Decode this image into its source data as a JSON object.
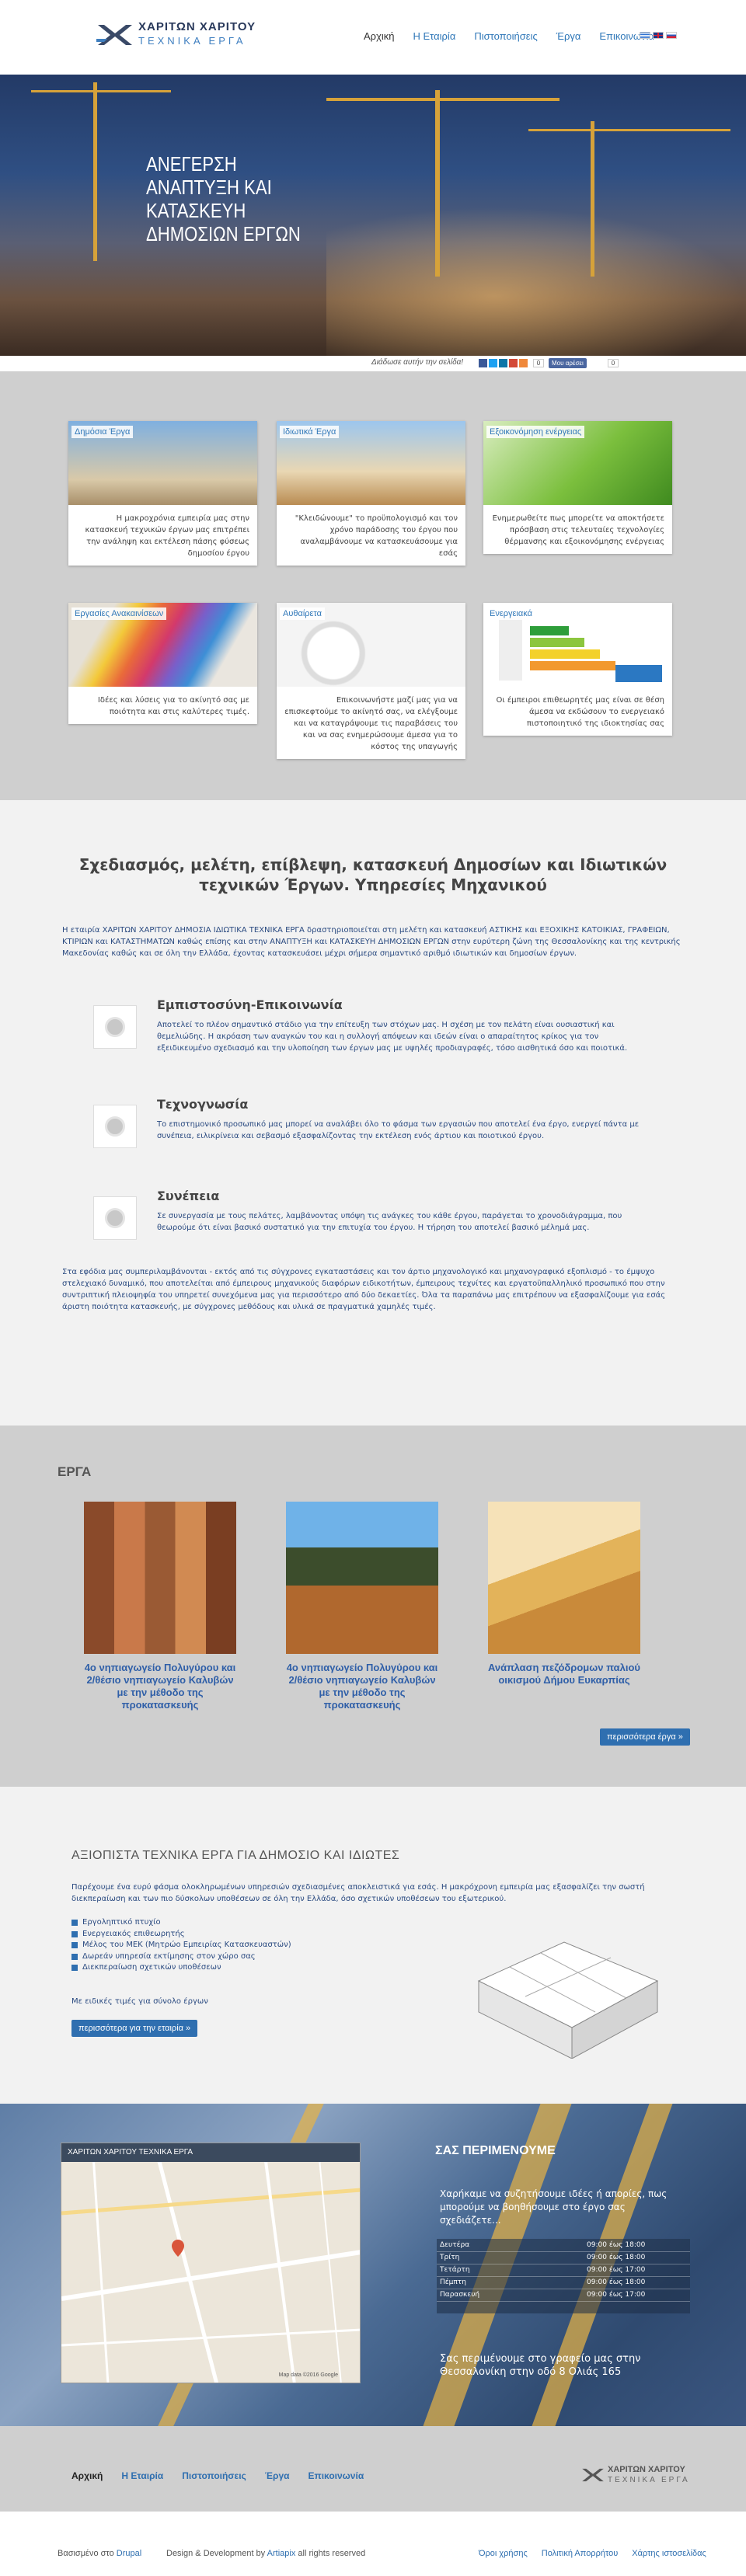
{
  "header": {
    "logo_title": "ΧΑΡΙΤΩΝ ΧΑΡΙΤΟΥ",
    "logo_subtitle": "ΤΕΧΝΙΚΑ ΕΡΓΑ",
    "nav": [
      "Αρχική",
      "Η Εταιρία",
      "Πιστοποιήσεις",
      "Έργα",
      "Επικοινωνία"
    ],
    "languages": [
      "greek-flag",
      "uk-flag",
      "russian-flag"
    ]
  },
  "hero": {
    "title": "ΑΝΕΓΕΡΣΗ ΑΝΑΠΤΥΞΗ ΚΑΙ ΚΑΤΑΣΚΕΥΗ ΔΗΜΟΣΙΩΝ ΕΡΓΩΝ"
  },
  "share": {
    "label": "Διάδωσε αυτήν την σελίδα!",
    "count": "0",
    "like_label": "Μου αρέσει",
    "like_count": "0"
  },
  "services": [
    {
      "label": "Δημόσια Έργα",
      "text": "Η μακροχρόνια εμπειρία μας στην κατασκευή τεχνικών έργων μας επιτρέπει την ανάληψη και εκτέλεση πάσης φύσεως δημοσίου έργου"
    },
    {
      "label": "Ιδιωτικά Έργα",
      "text": "\"Κλειδώνουμε\" το προϋπολογισμό και τον χρόνο παράδοσης του έργου που αναλαμβάνουμε να κατασκευάσουμε για εσάς"
    },
    {
      "label": "Εξοικονόμηση ενέργειας",
      "text": "Ενημερωθείτε πως μπορείτε να αποκτήσετε πρόσβαση στις τελευταίες τεχνολογίες θέρμανσης και εξοικονόμησης ενέργειας"
    },
    {
      "label": "Εργασίες Ανακαινίσεων",
      "text": "Ιδέες και λύσεις για το ακίνητό σας με ποιότητα και στις καλύτερες τιμές."
    },
    {
      "label": "Αυθαίρετα",
      "text": "Επικοινωνήστε μαζί μας για να επισκεφτούμε το ακίνητό σας, να ελέγξουμε και να καταγράψουμε τις παραβάσεις του και να σας ενημερώσουμε άμεσα για το κόστος της υπαγωγής"
    },
    {
      "label": "Ενεργειακά",
      "text": "Οι έμπειροι επιθεωρητές μας είναι σε θέση άμεσα να εκδώσουν το ενεργειακό πιστοποιητικό της ιδιοκτησίας σας"
    }
  ],
  "about": {
    "title": "Σχεδιασμός, μελέτη, επίβλεψη, κατασκευή Δημοσίων και Ιδιωτικών τεχνικών Έργων. Υπηρεσίες Μηχανικού",
    "intro": "Η εταιρία ΧΑΡΙΤΩΝ ΧΑΡΙΤΟΥ ΔΗΜΟΣΙΑ ΙΔΙΩΤΙΚΑ ΤΕΧΝΙΚΑ ΕΡΓΑ δραστηριοποιείται στη μελέτη και κατασκευή ΑΣΤΙΚΗΣ και ΕΞΟΧΙΚΗΣ ΚΑΤΟΙΚΙΑΣ, ΓΡΑΦΕΙΩΝ, ΚΤΙΡΙΩΝ και ΚΑΤΑΣΤΗΜΑΤΩΝ καθώς επίσης και στην ΑΝΑΠΤΥΞΗ και ΚΑΤΑΣΚΕΥΗ ΔΗΜΟΣΙΩΝ ΕΡΓΩΝ στην ευρύτερη ζώνη της Θεσσαλονίκης και της κεντρικής Μακεδονίας καθώς και σε όλη την Ελλάδα, έχοντας κατασκευάσει μέχρι σήμερα σημαντικό αριθμό ιδιωτικών και δημοσίων έργων.",
    "features": [
      {
        "title": "Εμπιστοσύνη-Επικοινωνία",
        "text": "Αποτελεί το πλέον σημαντικό στάδιο για την επίτευξη των στόχων μας. Η σχέση με τον πελάτη είναι ουσιαστική και θεμελιώδης. Η ακρόαση των αναγκών του και η συλλογή απόψεων και ιδεών είναι ο απαραίτητος κρίκος για τον εξειδικευμένο σχεδιασμό και την υλοποίηση των έργων μας με υψηλές προδιαγραφές, τόσο αισθητικά όσο και ποιοτικά."
      },
      {
        "title": "Τεχνογνωσία",
        "text": "Το επιστημονικό προσωπικό μας μπορεί να αναλάβει όλο το φάσμα των εργασιών που αποτελεί ένα έργο, ενεργεί πάντα με συνέπεια, ειλικρίνεια και σεβασμό εξασφαλίζοντας την εκτέλεση ενός άρτιου και ποιοτικού έργου."
      },
      {
        "title": "Συνέπεια",
        "text": "Σε συνεργασία με τους πελάτες, λαμβάνοντας υπόψη τις ανάγκες του κάθε έργου, παράγεται το χρονοδιάγραμμα, που θεωρούμε ότι είναι βασικό συστατικό για την επιτυχία του έργου. Η τήρηση του αποτελεί βασικό μέλημά μας."
      }
    ],
    "outro": "Στα εφόδια μας συμπεριλαμβάνονται - εκτός από τις σύγχρονες εγκαταστάσεις και τον άρτιο μηχανολογικό και μηχανογραφικό εξοπλισμό - το έμψυχο στελεχιακό δυναμικό, που αποτελείται από έμπειρους μηχανικούς διαφόρων ειδικοτήτων, έμπειρους τεχνίτες και εργατοϋπαλληλικό προσωπικό που στην συντριπτική πλειοψηφία του υπηρετεί συνεχόμενα μας για περισσότερο από δύο δεκαετίες. Όλα τα παραπάνω μας επιτρέπουν να εξασφαλίζουμε για εσάς άριστη ποιότητα κατασκευής, με σύγχρονες μεθόδους και υλικά σε πραγματικά χαμηλές τιμές."
  },
  "projects": {
    "heading": "ΕΡΓΑ",
    "items": [
      "4ο νηπιαγωγείο Πολυγύρου και 2/θέσιο νηπιαγωγείο Καλυβών με την μέθοδο της προκατασκευής",
      "4ο νηπιαγωγείο Πολυγύρου και 2/θέσιο νηπιαγωγείο Καλυβών με την μέθοδο της προκατασκευής",
      "Ανάπλαση πεζόδρομων παλιού οικισμού Δήμου Ευκαρπίας"
    ],
    "more": "περισσότερα έργα »"
  },
  "why": {
    "title": "ΑΞΙΟΠΙΣΤΑ ΤΕΧΝΙΚΑ ΕΡΓΑ ΓΙΑ ΔΗΜΟΣΙΟ ΚΑΙ ΙΔΙΩΤΕΣ",
    "intro": "Παρέχουμε ένα ευρύ φάσμα ολοκληρωμένων υπηρεσιών σχεδιασμένες αποκλειστικά για εσάς. Η μακρόχρονη εμπειρία μας εξασφαλίζει την σωστή διεκπεραίωση και των πιο δύσκολων υποθέσεων σε όλη την Ελλάδα, όσο σχετικών υποθέσεων του εξωτερικού.",
    "list": [
      "Εργοληπτικό πτυχίο",
      "Ενεργειακός επιθεωρητής",
      "Μέλος του ΜΕΚ (Μητρώο Εμπειρίας Κατασκευαστών)",
      "Δωρεάν υπηρεσία εκτίμησης στον χώρο σας",
      "Διεκπεραίωση σχετικών υποθέσεων"
    ],
    "more_text": "Με ειδικές τιμές για σύνολο έργων",
    "button": "περισσότερα για την εταιρία »"
  },
  "contact": {
    "map_title": "ΧΑΡΙΤΩΝ ΧΑΡΙΤΟΥ ΤΕΧΝΙΚΑ ΕΡΓΑ",
    "map_footer": "Map data ©2016 Google",
    "title": "ΣΑΣ ΠΕΡΙΜΕΝΟΥΜΕ",
    "lead": "Χαρήκαμε να συζητήσουμε ιδέες ή απορίες, πως μπορούμε να βοηθήσουμε στο έργο σας σχεδιάζετε...",
    "hours": [
      {
        "day": "Δευτέρα",
        "time": "09:00 έως 18:00"
      },
      {
        "day": "Τρίτη",
        "time": "09:00 έως 18:00"
      },
      {
        "day": "Τετάρτη",
        "time": "09:00 έως 17:00"
      },
      {
        "day": "Πέμπτη",
        "time": "09:00 έως 18:00"
      },
      {
        "day": "Παρασκευή",
        "time": "09:00 έως 17:00"
      }
    ],
    "footer_text": "Σας περιμένουμε στο γραφείο μας στην Θεσσαλονίκη στην οδό 8 Ολιάς 165"
  },
  "footer": {
    "nav": [
      "Αρχική",
      "Η Εταιρία",
      "Πιστοποιήσεις",
      "Έργα",
      "Επικοινωνία"
    ],
    "logo_title": "ΧΑΡΙΤΩΝ ΧΑΡΙΤΟΥ",
    "logo_subtitle": "ΤΕΧΝΙΚΑ ΕΡΓΑ",
    "credit_prefix": "Βασισμένο στο",
    "credit_link": "Drupal",
    "design_prefix": "Design & Development by",
    "design_link": "Artiapix",
    "design_suffix": "all rights reserved",
    "legal": [
      "Όροι χρήσης",
      "Πολιτική Απορρήτου",
      "Χάρτης ιστοσελίδας"
    ]
  }
}
